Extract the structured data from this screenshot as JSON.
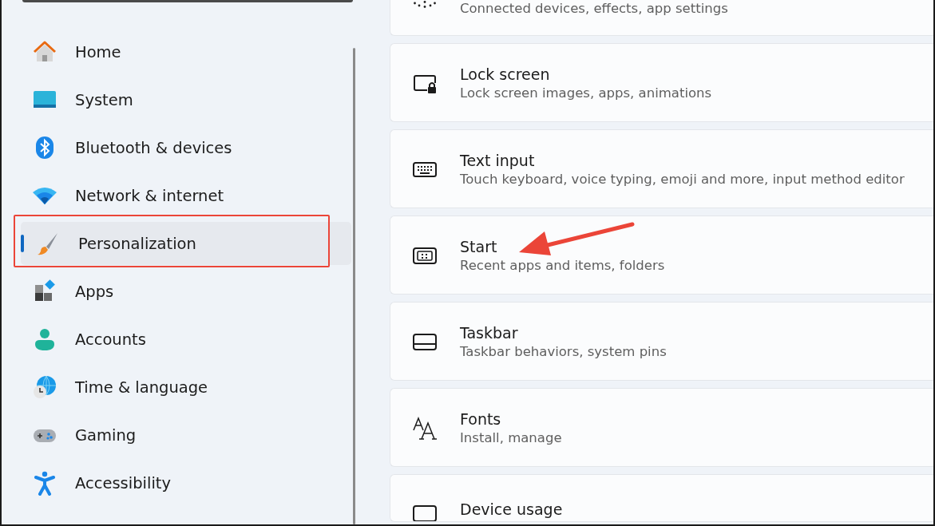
{
  "sidebar": {
    "items": [
      {
        "label": "Home",
        "selected": false
      },
      {
        "label": "System",
        "selected": false
      },
      {
        "label": "Bluetooth & devices",
        "selected": false
      },
      {
        "label": "Network & internet",
        "selected": false
      },
      {
        "label": "Personalization",
        "selected": true
      },
      {
        "label": "Apps",
        "selected": false
      },
      {
        "label": "Accounts",
        "selected": false
      },
      {
        "label": "Time & language",
        "selected": false
      },
      {
        "label": "Gaming",
        "selected": false
      },
      {
        "label": "Accessibility",
        "selected": false
      }
    ]
  },
  "cards": [
    {
      "subtitle": "Connected devices, effects, app settings"
    },
    {
      "title": "Lock screen",
      "subtitle": "Lock screen images, apps, animations"
    },
    {
      "title": "Text input",
      "subtitle": "Touch keyboard, voice typing, emoji and more, input method editor"
    },
    {
      "title": "Start",
      "subtitle": "Recent apps and items, folders"
    },
    {
      "title": "Taskbar",
      "subtitle": "Taskbar behaviors, system pins"
    },
    {
      "title": "Fonts",
      "subtitle": "Install, manage"
    },
    {
      "title": "Device usage"
    }
  ]
}
